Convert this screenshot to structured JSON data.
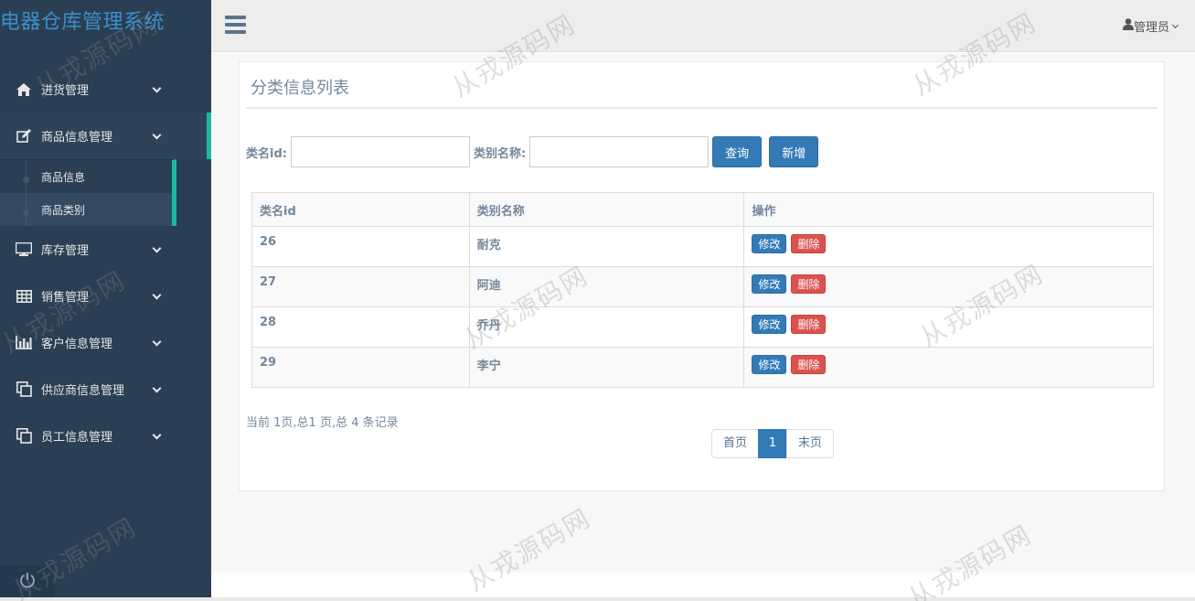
{
  "app": {
    "title": "电器仓库管理系统"
  },
  "sidebar": {
    "menus": [
      {
        "label": "进货管理",
        "icon": "home-icon"
      },
      {
        "label": "商品信息管理",
        "icon": "edit-icon",
        "active": true,
        "sub": [
          {
            "label": "商品信息"
          },
          {
            "label": "商品类别",
            "current": true
          }
        ]
      },
      {
        "label": "库存管理",
        "icon": "desktop-icon"
      },
      {
        "label": "销售管理",
        "icon": "table-icon"
      },
      {
        "label": "客户信息管理",
        "icon": "bar-chart-icon"
      },
      {
        "label": "供应商信息管理",
        "icon": "clone-icon"
      },
      {
        "label": "员工信息管理",
        "icon": "clone-icon"
      }
    ],
    "power_icon": "power-icon"
  },
  "header": {
    "user_label": "管理员",
    "user_icon": "user-icon",
    "menu_icon": "hamburger-icon"
  },
  "panel": {
    "title": "分类信息列表"
  },
  "search": {
    "id_label": "类名id:",
    "id_value": "",
    "name_label": "类别名称:",
    "name_value": "",
    "query_button": "查询",
    "add_button": "新增"
  },
  "table": {
    "headers": [
      "类名id",
      "类别名称",
      "操作"
    ],
    "rows": [
      {
        "id": "26",
        "name": "耐克"
      },
      {
        "id": "27",
        "name": "阿迪"
      },
      {
        "id": "28",
        "name": "乔丹"
      },
      {
        "id": "29",
        "name": "李宁"
      }
    ],
    "edit_label": "修改",
    "delete_label": "删除"
  },
  "pagination": {
    "summary": "当前 1页,总1 页,总 4 条记录",
    "first": "首页",
    "current": "1",
    "last": "末页"
  },
  "watermark": "从戎源码网",
  "colors": {
    "sidebar": "#2a3f54",
    "accent": "#1abb9c",
    "primary": "#337ab7",
    "danger": "#d9534f"
  }
}
